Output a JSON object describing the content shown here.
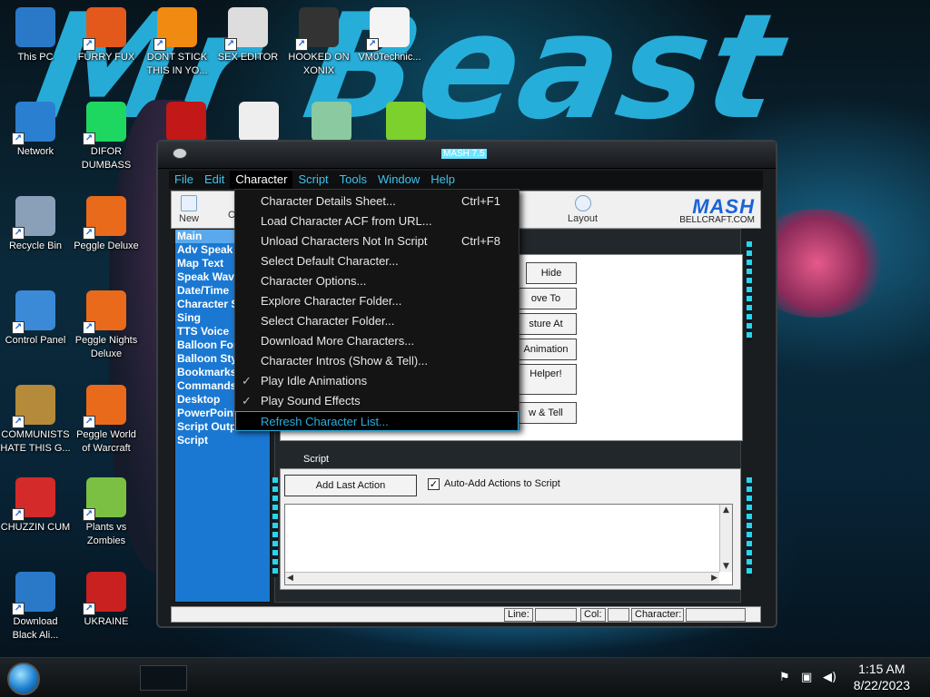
{
  "desktop": {
    "icons": [
      {
        "label": "This PC",
        "icon": "computer-icon"
      },
      {
        "label": "FURRY FUX",
        "icon": "firefox-icon"
      },
      {
        "label": "DONT STICK THIS IN YO...",
        "icon": "vlc-icon"
      },
      {
        "label": "SEX EDITOR",
        "icon": "hxd-icon"
      },
      {
        "label": "HOOKED ON XONIX",
        "icon": "xonix-icon"
      },
      {
        "label": "VM0Technic...",
        "icon": "doctor-icon"
      },
      {
        "label": "Network",
        "icon": "network-icon"
      },
      {
        "label": "DIFOR DUMBASS",
        "icon": "spotify-icon"
      },
      {
        "label": "Recycle Bin",
        "icon": "recycle-bin-icon"
      },
      {
        "label": "Peggle Deluxe",
        "icon": "peggle-icon"
      },
      {
        "label": "Control Panel",
        "icon": "control-panel-icon"
      },
      {
        "label": "Peggle Nights Deluxe",
        "icon": "peggle-nights-icon"
      },
      {
        "label": "COMMUNISTS HATE THIS G...",
        "icon": "money-bag-icon"
      },
      {
        "label": "Peggle World of Warcraft",
        "icon": "peggle-wow-icon"
      },
      {
        "label": "CHUZZIN CUM",
        "icon": "chuzzle-icon"
      },
      {
        "label": "Plants vs Zombies",
        "icon": "pvz-icon"
      },
      {
        "label": "Download Black Ali...",
        "icon": "globe-download-icon"
      },
      {
        "label": "UKRAINE",
        "icon": "radiation-icon"
      }
    ],
    "row2_unlabeled": [
      "dev-cpp-icon",
      "cursor-app-icon",
      "santa-icon",
      "limewire-icon"
    ],
    "wallpaper_text": "Mr Beast"
  },
  "window": {
    "title": "MASH 7.5",
    "menu": [
      "File",
      "Edit",
      "Character",
      "Script",
      "Tools",
      "Window",
      "Help"
    ],
    "open_menu": "Character",
    "toolbar": {
      "new_label": "New",
      "c_label": "C",
      "layout_label": "Layout",
      "logo": "MASH",
      "logo_sub": "BELLCRAFT.COM"
    },
    "sidebar": [
      "Main",
      "Adv Speak",
      "Map Text",
      "Speak Wav",
      "Date/Time",
      "Character S",
      "Sing",
      "TTS Voice",
      "Balloon Fon",
      "Balloon Sty",
      "Bookmarks",
      "Commands",
      "Desktop",
      "PowerPoint",
      "Script Outp",
      "Script"
    ],
    "properties_buttons": {
      "hide": "Hide",
      "move_to": "ove To",
      "gesture_at": "sture At",
      "animation": "Animation",
      "helper": "Helper!",
      "show_tell": "w & Tell"
    },
    "script": {
      "title": "Script",
      "add_last_action": "Add Last Action",
      "auto_add_label": "Auto-Add Actions to Script",
      "auto_add_checked": "✓"
    },
    "status": {
      "line_label": "Line:",
      "col_label": "Col:",
      "character_label": "Character:"
    }
  },
  "character_menu": [
    {
      "label": "Character Details Sheet...",
      "shortcut": "Ctrl+F1",
      "check": ""
    },
    {
      "label": "Load Character ACF from URL...",
      "shortcut": "",
      "check": ""
    },
    {
      "label": "Unload Characters Not In Script",
      "shortcut": "Ctrl+F8",
      "check": ""
    },
    {
      "label": "Select Default Character...",
      "shortcut": "",
      "check": ""
    },
    {
      "label": "Character Options...",
      "shortcut": "",
      "check": ""
    },
    {
      "label": "Explore Character Folder...",
      "shortcut": "",
      "check": ""
    },
    {
      "label": "Select Character Folder...",
      "shortcut": "",
      "check": ""
    },
    {
      "label": "Download More Characters...",
      "shortcut": "",
      "check": ""
    },
    {
      "label": "Character Intros (Show & Tell)...",
      "shortcut": "",
      "check": ""
    },
    {
      "label": "Play Idle Animations",
      "shortcut": "",
      "check": "✓"
    },
    {
      "label": "Play Sound Effects",
      "shortcut": "",
      "check": "✓"
    },
    {
      "label": "Refresh Character List...",
      "shortcut": "",
      "check": ""
    }
  ],
  "taskbar": {
    "time": "1:15 AM",
    "date": "8/22/2023"
  },
  "colors": {
    "accent_cyan": "#27d5ef",
    "menu_text": "#3ec3ee",
    "sidebar_blue": "#1a78d2",
    "highlight_border": "#27a8d8"
  }
}
